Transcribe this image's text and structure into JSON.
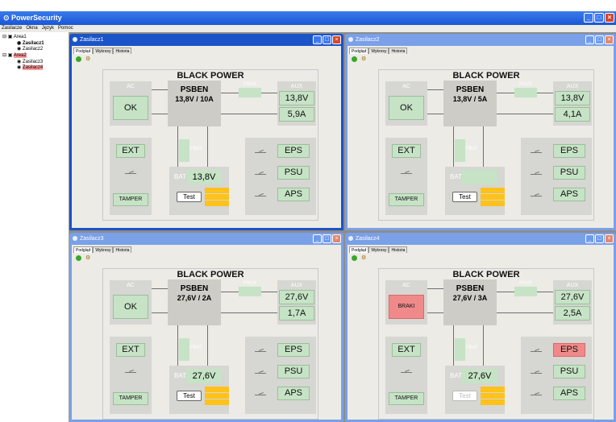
{
  "app": {
    "title": "PowerSecurity",
    "title_icon": "power-icon"
  },
  "menu": [
    "Zasilacze",
    "Okna",
    "Język",
    "Pomoc"
  ],
  "tree": {
    "items": [
      {
        "label": "Area1",
        "level": 0
      },
      {
        "label": "Zasilacz1",
        "level": 1
      },
      {
        "label": "Zasilacz2",
        "level": 1
      },
      {
        "label": "Area2",
        "level": 0
      },
      {
        "label": "Zasilacz3",
        "level": 1
      },
      {
        "label": "Zasilacz4",
        "level": 1
      }
    ]
  },
  "colors": {
    "titlebar": "#1a56d6",
    "ok_green": "#c6e3c6",
    "alarm_red": "#f08a8a",
    "battery_yellow": "#ffc21a",
    "disabled_text": "#ffffff"
  },
  "windows": [
    {
      "title": "Zasilacz1",
      "tabs": [
        "Podgląd",
        "Wykresy",
        "Historia"
      ],
      "active_tab": "Podgląd",
      "brand": "BLACK POWER",
      "model": "PSBEN",
      "spec": "13,8V / 10A",
      "ac_label": "AC",
      "ac_status": "OK",
      "aux_label": "AUX",
      "aux_voltage": "13,8V",
      "aux_current": "5,9A",
      "faux": "FAUX",
      "fbat": "FBAT",
      "bat_label": "BAT",
      "bat_voltage": "13,8V",
      "ext": "EXT",
      "tamper": "TAMPER",
      "eps": "EPS",
      "psu": "PSU",
      "aps": "APS",
      "test": "Test",
      "active": true
    },
    {
      "title": "Zasilacz2",
      "tabs": [
        "Podgląd",
        "Wykresy",
        "Historia"
      ],
      "active_tab": "Podgląd",
      "brand": "BLACK POWER",
      "model": "PSBEN",
      "spec": "13,8V / 5A",
      "ac_label": "AC",
      "ac_status": "OK",
      "aux_label": "AUX",
      "aux_voltage": "13,8V",
      "aux_current": "4,1A",
      "faux": "FAUX",
      "fbat": "FBAT",
      "bat_label": "BAT",
      "bat_voltage": "",
      "ext": "EXT",
      "tamper": "TAMPER",
      "eps": "EPS",
      "psu": "PSU",
      "aps": "APS",
      "test": "Test",
      "active": false
    },
    {
      "title": "Zasilacz3",
      "tabs": [
        "Podgląd",
        "Wykresy",
        "Historia"
      ],
      "active_tab": "Podgląd",
      "brand": "BLACK POWER",
      "model": "PSBEN",
      "spec": "27,6V / 2A",
      "ac_label": "AC",
      "ac_status": "OK",
      "aux_label": "AUX",
      "aux_voltage": "27,6V",
      "aux_current": "1,7A",
      "faux": "FAUX",
      "fbat": "FBAT",
      "bat_label": "BAT",
      "bat_voltage": "27,6V",
      "ext": "EXT",
      "tamper": "TAMPER",
      "eps": "EPS",
      "psu": "PSU",
      "aps": "APS",
      "test": "Test",
      "active": false
    },
    {
      "title": "Zasilacz4",
      "tabs": [
        "Podgląd",
        "Wykresy",
        "Historia"
      ],
      "active_tab": "Podgląd",
      "brand": "BLACK POWER",
      "model": "PSBEN",
      "spec": "27,6V / 3A",
      "ac_label": "AC",
      "ac_status": "BRAKI",
      "aux_label": "AUX",
      "aux_voltage": "27,6V",
      "aux_current": "2,5A",
      "faux": "FAUX",
      "fbat": "FBAT",
      "bat_label": "BAT",
      "bat_voltage": "27,6V",
      "ext": "EXT",
      "tamper": "TAMPER",
      "eps": "EPS",
      "psu": "PSU",
      "aps": "APS",
      "test": "Test",
      "active": false
    }
  ]
}
